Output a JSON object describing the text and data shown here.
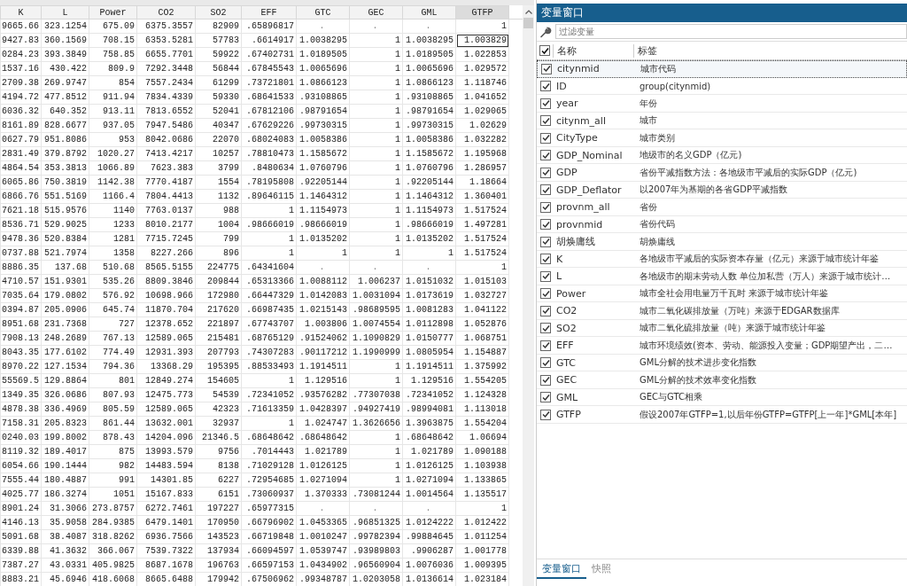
{
  "data_grid": {
    "columns": [
      {
        "label": "K",
        "selected": false
      },
      {
        "label": "L",
        "selected": false
      },
      {
        "label": "Power",
        "selected": false
      },
      {
        "label": "CO2",
        "selected": false
      },
      {
        "label": "SO2",
        "selected": false
      },
      {
        "label": "EFF",
        "selected": false
      },
      {
        "label": "GTC",
        "selected": false
      },
      {
        "label": "GEC",
        "selected": false
      },
      {
        "label": "GML",
        "selected": false
      },
      {
        "label": "GTFP",
        "selected": true
      }
    ],
    "rows": [
      {
        "selected": false,
        "cells": [
          "9665.66",
          "323.1254",
          "675.09",
          "6375.3557",
          "82909",
          ".65896817",
          ".",
          ".",
          ".",
          "1"
        ]
      },
      {
        "selected": true,
        "cells": [
          "9427.83",
          "360.1569",
          "708.15",
          "6353.5281",
          "57783",
          ".6614917",
          "1.0038295",
          "1",
          "1.0038295",
          "1.003829"
        ]
      },
      {
        "selected": false,
        "cells": [
          "0284.23",
          "393.3849",
          "758.85",
          "6655.7701",
          "59922",
          ".67402731",
          "1.0189505",
          "1",
          "1.0189505",
          "1.022853"
        ]
      },
      {
        "selected": false,
        "cells": [
          "1537.16",
          "430.422",
          "809.9",
          "7292.3448",
          "56844",
          ".67845543",
          "1.0065696",
          "1",
          "1.0065696",
          "1.029572"
        ]
      },
      {
        "selected": false,
        "cells": [
          "2709.38",
          "269.9747",
          "854",
          "7557.2434",
          "61299",
          ".73721801",
          "1.0866123",
          "1",
          "1.0866123",
          "1.118746"
        ]
      },
      {
        "selected": false,
        "cells": [
          "4194.72",
          "477.8512",
          "911.94",
          "7834.4339",
          "59330",
          ".68641533",
          ".93108865",
          "1",
          ".93108865",
          "1.041652"
        ]
      },
      {
        "selected": false,
        "cells": [
          "6036.32",
          "640.352",
          "913.11",
          "7813.6552",
          "52041",
          ".67812106",
          ".98791654",
          "1",
          ".98791654",
          "1.029065"
        ]
      },
      {
        "selected": false,
        "cells": [
          "8161.89",
          "828.6677",
          "937.05",
          "7947.5486",
          "40347",
          ".67629226",
          ".99730315",
          "1",
          ".99730315",
          "1.02629"
        ]
      },
      {
        "selected": false,
        "cells": [
          "0627.79",
          "951.8086",
          "953",
          "8042.0686",
          "22070",
          ".68024083",
          "1.0058386",
          "1",
          "1.0058386",
          "1.032282"
        ]
      },
      {
        "selected": false,
        "cells": [
          "2831.49",
          "379.8792",
          "1020.27",
          "7413.4217",
          "10257",
          ".78810473",
          "1.1585672",
          "1",
          "1.1585672",
          "1.195968"
        ]
      },
      {
        "selected": false,
        "cells": [
          "4864.54",
          "353.3813",
          "1066.89",
          "7623.383",
          "3799",
          ".8480634",
          "1.0760796",
          "1",
          "1.0760796",
          "1.286957"
        ]
      },
      {
        "selected": false,
        "cells": [
          "6065.86",
          "750.3819",
          "1142.38",
          "7770.4187",
          "1554",
          ".78195808",
          ".92205144",
          "1",
          ".92205144",
          "1.18664"
        ]
      },
      {
        "selected": false,
        "cells": [
          "6866.76",
          "551.5169",
          "1166.4",
          "7804.4413",
          "1132",
          ".89646115",
          "1.1464312",
          "1",
          "1.1464312",
          "1.360401"
        ]
      },
      {
        "selected": false,
        "cells": [
          "7621.18",
          "515.9576",
          "1140",
          "7763.0137",
          "988",
          "1",
          "1.1154973",
          "1",
          "1.1154973",
          "1.517524"
        ]
      },
      {
        "selected": false,
        "cells": [
          "8536.71",
          "529.9025",
          "1233",
          "8010.2177",
          "1004",
          ".98666019",
          ".98666019",
          "1",
          ".98666019",
          "1.497281"
        ]
      },
      {
        "selected": false,
        "cells": [
          "9478.36",
          "520.8384",
          "1281",
          "7715.7245",
          "799",
          "1",
          "1.0135202",
          "1",
          "1.0135202",
          "1.517524"
        ]
      },
      {
        "selected": false,
        "cells": [
          "0737.88",
          "521.7974",
          "1358",
          "8227.266",
          "896",
          "1",
          "1",
          "1",
          "1",
          "1.517524"
        ]
      },
      {
        "selected": false,
        "cells": [
          "8886.35",
          "137.68",
          "510.68",
          "8565.5155",
          "224775",
          ".64341604",
          ".",
          ".",
          ".",
          "1"
        ]
      },
      {
        "selected": false,
        "cells": [
          "4710.57",
          "151.9301",
          "535.26",
          "8809.3846",
          "209844",
          ".65313366",
          "1.0088112",
          "1.006237",
          "1.0151032",
          "1.015103"
        ]
      },
      {
        "selected": false,
        "cells": [
          "7035.64",
          "179.0802",
          "576.92",
          "10698.966",
          "172980",
          ".66447329",
          "1.0142083",
          "1.0031094",
          "1.0173619",
          "1.032727"
        ]
      },
      {
        "selected": false,
        "cells": [
          "0394.87",
          "205.0906",
          "645.74",
          "11870.704",
          "217620",
          ".66987435",
          "1.0215143",
          ".98689595",
          "1.0081283",
          "1.041122"
        ]
      },
      {
        "selected": false,
        "cells": [
          "8951.68",
          "231.7368",
          "727",
          "12378.652",
          "221897",
          ".67743707",
          "1.003806",
          "1.0074554",
          "1.0112898",
          "1.052876"
        ]
      },
      {
        "selected": false,
        "cells": [
          "7908.13",
          "248.2689",
          "767.13",
          "12589.065",
          "215481",
          ".68765129",
          ".91524062",
          "1.1090829",
          "1.0150777",
          "1.068751"
        ]
      },
      {
        "selected": false,
        "cells": [
          "8043.35",
          "177.6102",
          "774.49",
          "12931.393",
          "207793",
          ".74307283",
          ".90117212",
          "1.1990999",
          "1.0805954",
          "1.154887"
        ]
      },
      {
        "selected": false,
        "cells": [
          "8970.22",
          "127.1534",
          "794.36",
          "13368.29",
          "195395",
          ".88533493",
          "1.1914511",
          "1",
          "1.1914511",
          "1.375992"
        ]
      },
      {
        "selected": false,
        "cells": [
          "55569.5",
          "129.8864",
          "801",
          "12849.274",
          "154605",
          "1",
          "1.129516",
          "1",
          "1.129516",
          "1.554205"
        ]
      },
      {
        "selected": false,
        "cells": [
          "1349.35",
          "326.0686",
          "807.93",
          "12475.773",
          "54539",
          ".72341052",
          ".93576282",
          ".77307038",
          ".72341052",
          "1.124328"
        ]
      },
      {
        "selected": false,
        "cells": [
          "4878.38",
          "336.4969",
          "805.59",
          "12589.065",
          "42323",
          ".71613359",
          "1.0428397",
          ".94927419",
          ".98994081",
          "1.113018"
        ]
      },
      {
        "selected": false,
        "cells": [
          "7158.31",
          "205.8323",
          "861.44",
          "13632.001",
          "32937",
          "1",
          "1.024747",
          "1.3626656",
          "1.3963875",
          "1.554204"
        ]
      },
      {
        "selected": false,
        "cells": [
          "0240.03",
          "199.8002",
          "878.43",
          "14204.096",
          "21346.5",
          ".68648642",
          ".68648642",
          "1",
          ".68648642",
          "1.06694"
        ]
      },
      {
        "selected": false,
        "cells": [
          "8119.32",
          "189.4017",
          "875",
          "13993.579",
          "9756",
          ".7014443",
          "1.021789",
          "1",
          "1.021789",
          "1.090188"
        ]
      },
      {
        "selected": false,
        "cells": [
          "6054.66",
          "190.1444",
          "982",
          "14483.594",
          "8138",
          ".71029128",
          "1.0126125",
          "1",
          "1.0126125",
          "1.103938"
        ]
      },
      {
        "selected": false,
        "cells": [
          "7555.44",
          "180.4887",
          "991",
          "14301.85",
          "6227",
          ".72954685",
          "1.0271094",
          "1",
          "1.0271094",
          "1.133865"
        ]
      },
      {
        "selected": false,
        "cells": [
          "4025.77",
          "186.3274",
          "1051",
          "15167.833",
          "6151",
          ".73060937",
          "1.370333",
          ".73081244",
          "1.0014564",
          "1.135517"
        ]
      },
      {
        "selected": false,
        "cells": [
          "8901.24",
          "31.3066",
          "273.8757",
          "6272.7461",
          "197227",
          ".65977315",
          ".",
          ".",
          ".",
          "1"
        ]
      },
      {
        "selected": false,
        "cells": [
          "4146.13",
          "35.9058",
          "284.9385",
          "6479.1401",
          "170950",
          ".66796902",
          "1.0453365",
          ".96851325",
          "1.0124222",
          "1.012422"
        ]
      },
      {
        "selected": false,
        "cells": [
          "5091.68",
          "38.4087",
          "318.8262",
          "6936.7566",
          "143523",
          ".66719848",
          "1.0010247",
          ".99782394",
          ".99884645",
          "1.011254"
        ]
      },
      {
        "selected": false,
        "cells": [
          "6339.88",
          "41.3632",
          "366.067",
          "7539.7322",
          "137934",
          ".66094597",
          "1.0539747",
          ".93989803",
          ".9906287",
          "1.001778"
        ]
      },
      {
        "selected": false,
        "cells": [
          "7387.27",
          "43.0331",
          "405.9825",
          "8687.1678",
          "196763",
          ".66597153",
          "1.0434902",
          ".96560904",
          "1.0076036",
          "1.009395"
        ]
      },
      {
        "selected": false,
        "cells": [
          "8883.21",
          "45.6946",
          "418.6068",
          "8665.6488",
          "179942",
          ".67506962",
          ".99348787",
          "1.0203058",
          "1.0136614",
          "1.023184"
        ]
      }
    ]
  },
  "variable_window": {
    "title": "变量窗口",
    "filter": {
      "placeholder": "过滤变量"
    },
    "header": {
      "checked": true,
      "name": "名称",
      "label": "标签"
    },
    "variables": [
      {
        "name": "citynmid",
        "label": "城市代码",
        "checked": true,
        "selected": true
      },
      {
        "name": "ID",
        "label": "group(citynmid)",
        "checked": true,
        "selected": false
      },
      {
        "name": "year",
        "label": "年份",
        "checked": true,
        "selected": false
      },
      {
        "name": "citynm_all",
        "label": "城市",
        "checked": true,
        "selected": false
      },
      {
        "name": "CityType",
        "label": "城市类别",
        "checked": true,
        "selected": false
      },
      {
        "name": "GDP_Nominal",
        "label": "地级市的名义GDP（亿元)",
        "checked": true,
        "selected": false
      },
      {
        "name": "GDP",
        "label": "省份平减指数方法：各地级市平减后的实际GDP（亿元)",
        "checked": true,
        "selected": false
      },
      {
        "name": "GDP_Deflator",
        "label": "以2007年为基期的各省GDP平减指数",
        "checked": true,
        "selected": false
      },
      {
        "name": "provnm_all",
        "label": "省份",
        "checked": true,
        "selected": false
      },
      {
        "name": "provnmid",
        "label": "省份代码",
        "checked": true,
        "selected": false
      },
      {
        "name": "胡焕庸线",
        "label": "胡焕庸线",
        "checked": true,
        "selected": false
      },
      {
        "name": "K",
        "label": "各地级市平减后的实际资本存量（亿元）来源于城市统计年鉴",
        "checked": true,
        "selected": false
      },
      {
        "name": "L",
        "label": "各地级市的期末劳动人数 单位加私营（万人）来源于城市统计…",
        "checked": true,
        "selected": false
      },
      {
        "name": "Power",
        "label": "城市全社会用电量万千瓦时 来源于城市统计年鉴",
        "checked": true,
        "selected": false
      },
      {
        "name": "CO2",
        "label": "城市二氧化碳排放量（万吨）来源于EDGAR数据库",
        "checked": true,
        "selected": false
      },
      {
        "name": "SO2",
        "label": "城市二氧化硫排放量（吨）来源于城市统计年鉴",
        "checked": true,
        "selected": false
      },
      {
        "name": "EFF",
        "label": "城市环境绩效(资本、劳动、能源投入变量；GDP期望产出，二…",
        "checked": true,
        "selected": false
      },
      {
        "name": "GTC",
        "label": "GML分解的技术进步变化指数",
        "checked": true,
        "selected": false
      },
      {
        "name": "GEC",
        "label": "GML分解的技术效率变化指数",
        "checked": true,
        "selected": false
      },
      {
        "name": "GML",
        "label": "GEC与GTC相乘",
        "checked": true,
        "selected": false
      },
      {
        "name": "GTFP",
        "label": "假设2007年GTFP=1,以后年份GTFP=GTFP[上一年]*GML[本年]",
        "checked": true,
        "selected": false
      }
    ],
    "tabs": [
      {
        "label": "变量窗口",
        "selected": true
      },
      {
        "label": "快照",
        "selected": false
      }
    ]
  }
}
